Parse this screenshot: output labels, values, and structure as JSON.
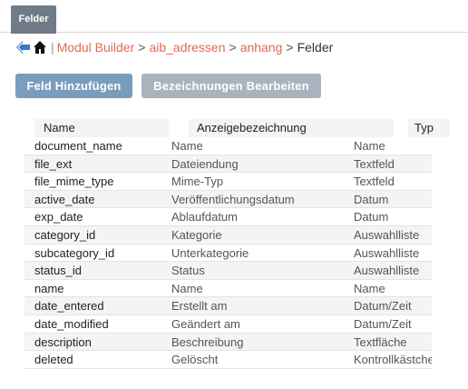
{
  "tab": {
    "label": "Felder"
  },
  "breadcrumb": {
    "separator": "|",
    "items": [
      "Modul Builder",
      "aib_adressen",
      "anhang"
    ],
    "current": "Felder",
    "arrow": ">"
  },
  "buttons": {
    "add_field": "Feld Hinzufügen",
    "edit_labels": "Bezeichnungen Bearbeiten"
  },
  "table": {
    "columns": [
      "Name",
      "Anzeigebezeichnung",
      "Typ"
    ],
    "rows": [
      [
        "document_name",
        "Name",
        "Name"
      ],
      [
        "file_ext",
        "Dateiendung",
        "Textfeld"
      ],
      [
        "file_mime_type",
        "Mime-Typ",
        "Textfeld"
      ],
      [
        "active_date",
        "Veröffentlichungsdatum",
        "Datum"
      ],
      [
        "exp_date",
        "Ablaufdatum",
        "Datum"
      ],
      [
        "category_id",
        "Kategorie",
        "Auswahlliste"
      ],
      [
        "subcategory_id",
        "Unterkategorie",
        "Auswahlliste"
      ],
      [
        "status_id",
        "Status",
        "Auswahlliste"
      ],
      [
        "name",
        "Name",
        "Name"
      ],
      [
        "date_entered",
        "Erstellt am",
        "Datum/Zeit"
      ],
      [
        "date_modified",
        "Geändert am",
        "Datum/Zeit"
      ],
      [
        "description",
        "Beschreibung",
        "Textfläche"
      ],
      [
        "deleted",
        "Gelöscht",
        "Kontrollkästchen"
      ]
    ]
  },
  "colors": {
    "tab_bg": "#6f7b86",
    "link": "#e06a4f",
    "back_arrow": "#3a78c8",
    "primary_button": "#7a9dbd",
    "secondary_button": "#a8b3bd"
  },
  "icons": {
    "back": "back-arrow-icon",
    "home": "home-icon"
  }
}
